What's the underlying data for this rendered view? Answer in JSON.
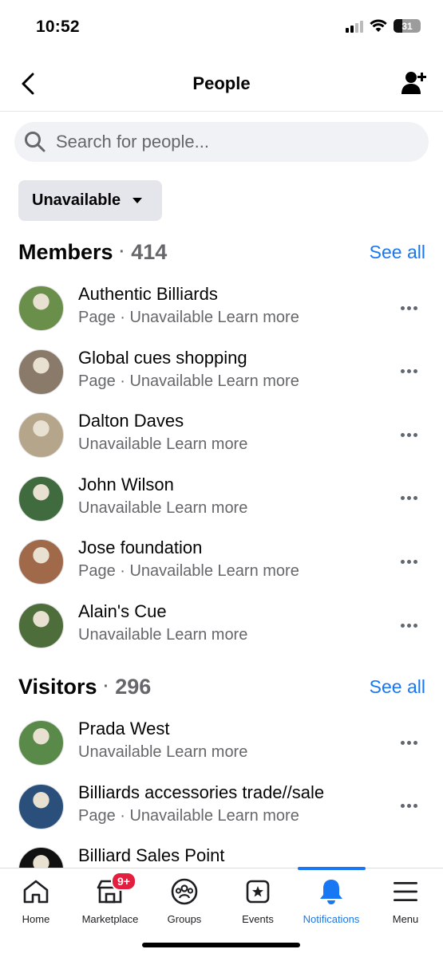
{
  "status": {
    "time": "10:52",
    "battery": "31"
  },
  "header": {
    "title": "People"
  },
  "search": {
    "placeholder": "Search for people..."
  },
  "filter": {
    "label": "Unavailable"
  },
  "members": {
    "title": "Members",
    "count": "414",
    "see_all": "See all",
    "items": [
      {
        "name": "Authentic Billiards",
        "sub": "Page · Unavailable Learn more",
        "avatar_color": "#6a8f4a"
      },
      {
        "name": "Global cues shopping",
        "sub": "Page · Unavailable Learn more",
        "avatar_color": "#8a7a6a"
      },
      {
        "name": "Dalton Daves",
        "sub": "Unavailable Learn more",
        "avatar_color": "#b5a58a"
      },
      {
        "name": "John Wilson",
        "sub": "Unavailable Learn more",
        "avatar_color": "#3f6b3f"
      },
      {
        "name": "Jose foundation",
        "sub": "Page · Unavailable Learn more",
        "avatar_color": "#a06a4a"
      },
      {
        "name": "Alain's Cue",
        "sub": "Unavailable Learn more",
        "avatar_color": "#4d6e3a"
      }
    ]
  },
  "visitors": {
    "title": "Visitors",
    "count": "296",
    "see_all": "See all",
    "items": [
      {
        "name": "Prada West",
        "sub": "Unavailable Learn more",
        "avatar_color": "#5a8a4a"
      },
      {
        "name": "Billiards accessories trade//sale",
        "sub": "Page · Unavailable Learn more",
        "avatar_color": "#2a4f7a"
      },
      {
        "name": "Billiard Sales Point",
        "sub": "",
        "avatar_color": "#111111"
      }
    ]
  },
  "tabs": {
    "home": "Home",
    "marketplace": "Marketplace",
    "marketplace_badge": "9+",
    "groups": "Groups",
    "events": "Events",
    "notifications": "Notifications",
    "menu": "Menu"
  },
  "colors": {
    "accent": "#1877f2",
    "badge": "#e41e3f"
  }
}
